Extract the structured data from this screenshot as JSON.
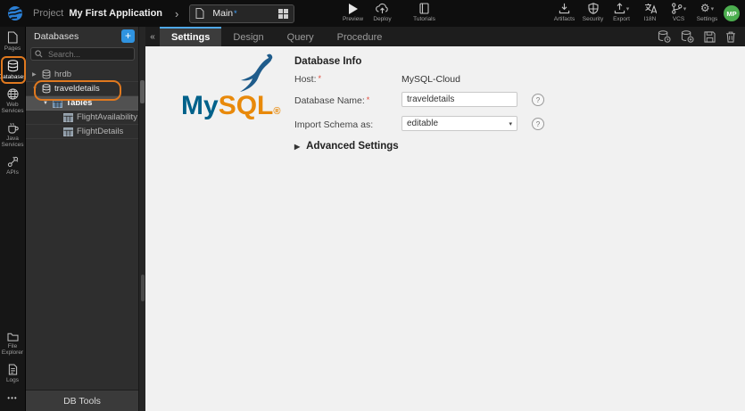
{
  "topbar": {
    "project_label": "Project",
    "project_name": "My First Application",
    "main_tab_label": "Main",
    "actions_left": [
      {
        "label": "Preview"
      },
      {
        "label": "Deploy"
      },
      {
        "label": "Tutorials"
      }
    ],
    "actions_right": [
      {
        "label": "Artifacts"
      },
      {
        "label": "Security"
      },
      {
        "label": "Export"
      },
      {
        "label": "I18N"
      },
      {
        "label": "VCS"
      },
      {
        "label": "Settings"
      }
    ],
    "avatar_initials": "MP"
  },
  "rail": {
    "items_top": [
      {
        "label": "Pages"
      },
      {
        "label": "Databases",
        "active": true
      },
      {
        "label": "Web Services"
      },
      {
        "label": "Java Services"
      },
      {
        "label": "APIs"
      }
    ],
    "items_bottom": [
      {
        "label": "File Explorer"
      },
      {
        "label": "Logs"
      }
    ]
  },
  "panel": {
    "title": "Databases",
    "add_label": "+",
    "search_placeholder": "Search...",
    "tree": [
      {
        "label": "hrdb"
      },
      {
        "label": "traveldetails"
      },
      {
        "label": "Tables"
      },
      {
        "label": "FlightAvailability"
      },
      {
        "label": "FlightDetails"
      }
    ],
    "footer": "DB Tools"
  },
  "workspace": {
    "tabs": [
      {
        "label": "Settings",
        "active": true
      },
      {
        "label": "Design"
      },
      {
        "label": "Query"
      },
      {
        "label": "Procedure"
      }
    ],
    "toolbar_icons": [
      "database-clock-pull-icon",
      "database-clock-push-icon",
      "save-icon",
      "trash-icon"
    ],
    "logo": {
      "part_blue": "My",
      "part_orange": "SQL",
      "registered": "®"
    },
    "form": {
      "heading": "Database Info",
      "host_label": "Host:",
      "host_value": "MySQL-Cloud",
      "dbname_label": "Database Name:",
      "dbname_value": "traveldetails",
      "schema_label": "Import Schema as:",
      "schema_value": "editable",
      "advanced_label": "Advanced Settings",
      "required_marker": "*",
      "help_glyph": "?"
    }
  },
  "icons": {
    "plus": "+",
    "collapse": "«",
    "chevron": "›",
    "unsaved": "*",
    "caret": "▾",
    "arrow_collapsed": "▶",
    "arrow_expanded": "▼",
    "ellipsis": "•••",
    "play": "▶",
    "gear": "⚙",
    "adv_triangle": "▶"
  },
  "colors": {
    "accent_blue": "#2f93e0",
    "tab_active_border": "#4fa8e8",
    "annotation_orange": "#e0791f",
    "avatar_green": "#4cae4f",
    "mysql_blue": "#00618a",
    "mysql_orange": "#e8890a",
    "required_red": "#e04b3c"
  }
}
